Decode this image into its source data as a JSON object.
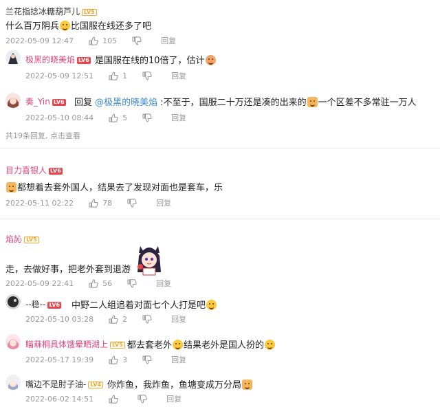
{
  "comments": [
    {
      "user": "兰花指捻冰糖葫芦儿",
      "level": "LV5",
      "text_before": "什么百万阴兵",
      "text_after": "比国服在线还多了吧",
      "time": "2022-05-09 12:47",
      "likes": "105",
      "reply": "回复",
      "replies": [
        {
          "user": "极黑的晓美焰",
          "level": "LV6",
          "text": "是国服在线的10倍了，估计",
          "time": "2022-05-09 12:51",
          "likes": "1",
          "reply": "回复"
        },
        {
          "user": "奏_Yin",
          "level": "LV6",
          "reply_prefix": "回复 ",
          "mention": "@极黑的晓美焰",
          "text_before": " :不至于，国服二十万还是凑的出来的",
          "text_after": "一个区差不多常驻一万人",
          "time": "2022-05-10 08:44",
          "likes": "5",
          "reply": "回复"
        }
      ],
      "more_replies": "共19条回复, 点击查看"
    },
    {
      "user": "目力喜银人",
      "level": "LV6",
      "text": "都想着去套外国人，结果去了发现对面也是套车，乐",
      "time": "2022-05-11 02:22",
      "likes": "78",
      "reply": "回复"
    },
    {
      "user": "焰訫",
      "level": "LV5",
      "text": "走，去做好事，把老外套到退游",
      "time": "2022-05-09 22:41",
      "likes": "56",
      "reply": "回复",
      "replies": [
        {
          "user": "--稳--",
          "level": "LV6",
          "text": "中野二人组追着对面七个人打是吧",
          "time": "2022-05-10 03:28",
          "likes": "2",
          "reply": "回复"
        },
        {
          "user": "瞄菻桐具体饿晕晒湖上",
          "level": "LV5",
          "text_before": "都去套老外",
          "text_after": "结果老外是国人扮的",
          "time": "2022-05-17 19:39",
          "likes": "3",
          "reply": "回复"
        },
        {
          "user": "嘴边不是肘子油-",
          "level": "LV4",
          "text": "你炸鱼，我炸鱼，鱼塘变成万分局",
          "time": "2022-06-02 14:51",
          "likes": "",
          "reply": "回复"
        }
      ]
    }
  ],
  "colors": {
    "username_pink": "#e0457b",
    "mention_blue": "#3b8bd6",
    "meta_gray": "#999999",
    "level_orange": "#f4a62a",
    "level_red": "#e8434a"
  },
  "icons": [
    "thumbs-up-icon",
    "thumbs-down-icon",
    "emoji-icon",
    "sticker-icon"
  ]
}
